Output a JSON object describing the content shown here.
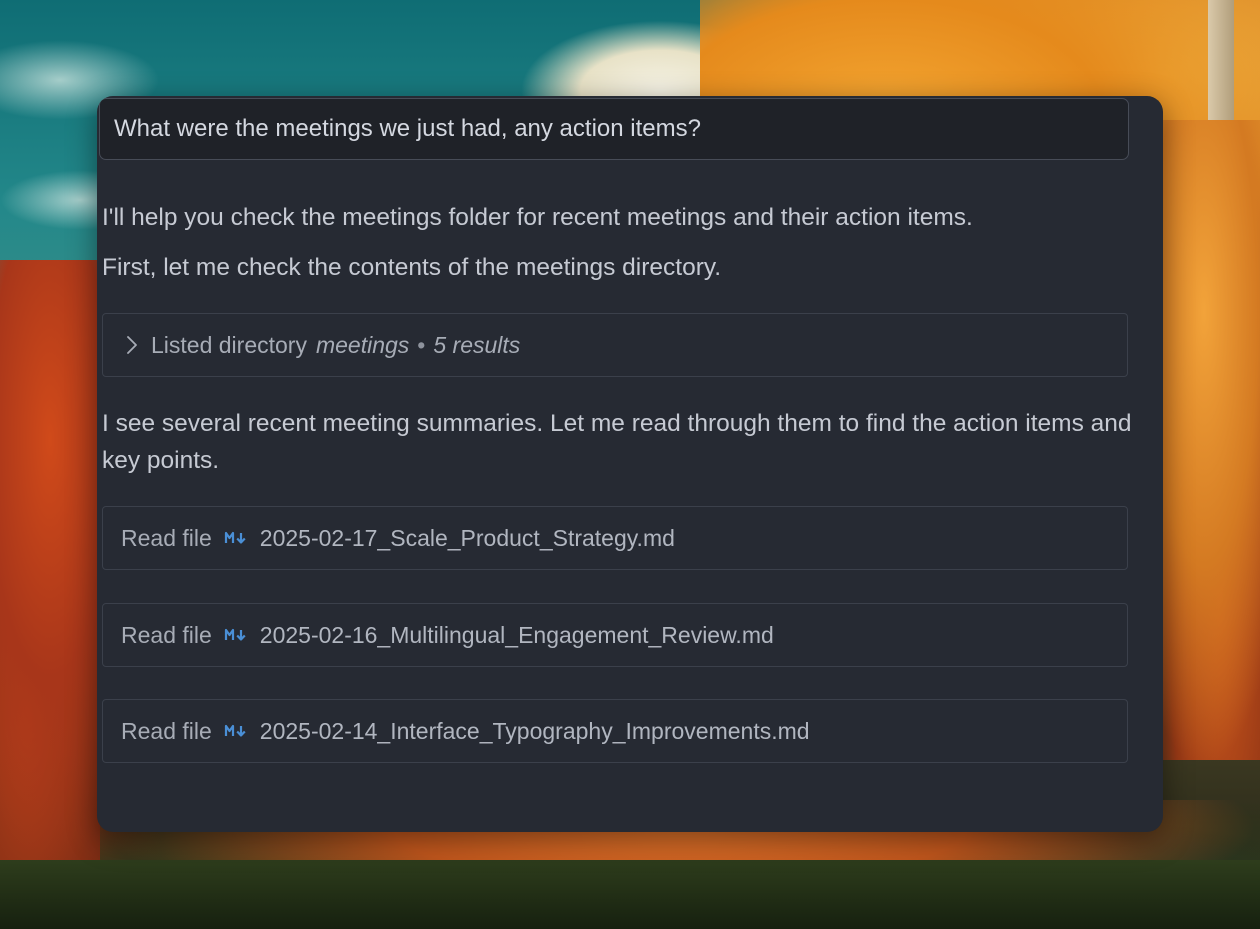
{
  "chat": {
    "prompt": "What were the meetings we just had, any action items?",
    "messages": [
      "I'll help you check the meetings folder for recent meetings and their action items.",
      "First, let me check the contents of the meetings directory.",
      "I see several recent meeting summaries. Let me read through them to find the action items and key points."
    ],
    "list_tool": {
      "label": "Listed directory",
      "target": "meetings",
      "separator": "•",
      "results": "5 results",
      "icon": "chevron-right-icon"
    },
    "file_reads": [
      {
        "label": "Read file",
        "icon": "markdown-icon",
        "filename": "2025-02-17_Scale_Product_Strategy.md"
      },
      {
        "label": "Read file",
        "icon": "markdown-icon",
        "filename": "2025-02-16_Multilingual_Engagement_Review.md"
      },
      {
        "label": "Read file",
        "icon": "markdown-icon",
        "filename": "2025-02-14_Interface_Typography_Improvements.md"
      }
    ]
  },
  "colors": {
    "panel_bg": "#262a33",
    "prompt_bg": "#1f2228",
    "text": "#c6cad3",
    "markdown_icon": "#4a8fd6"
  }
}
